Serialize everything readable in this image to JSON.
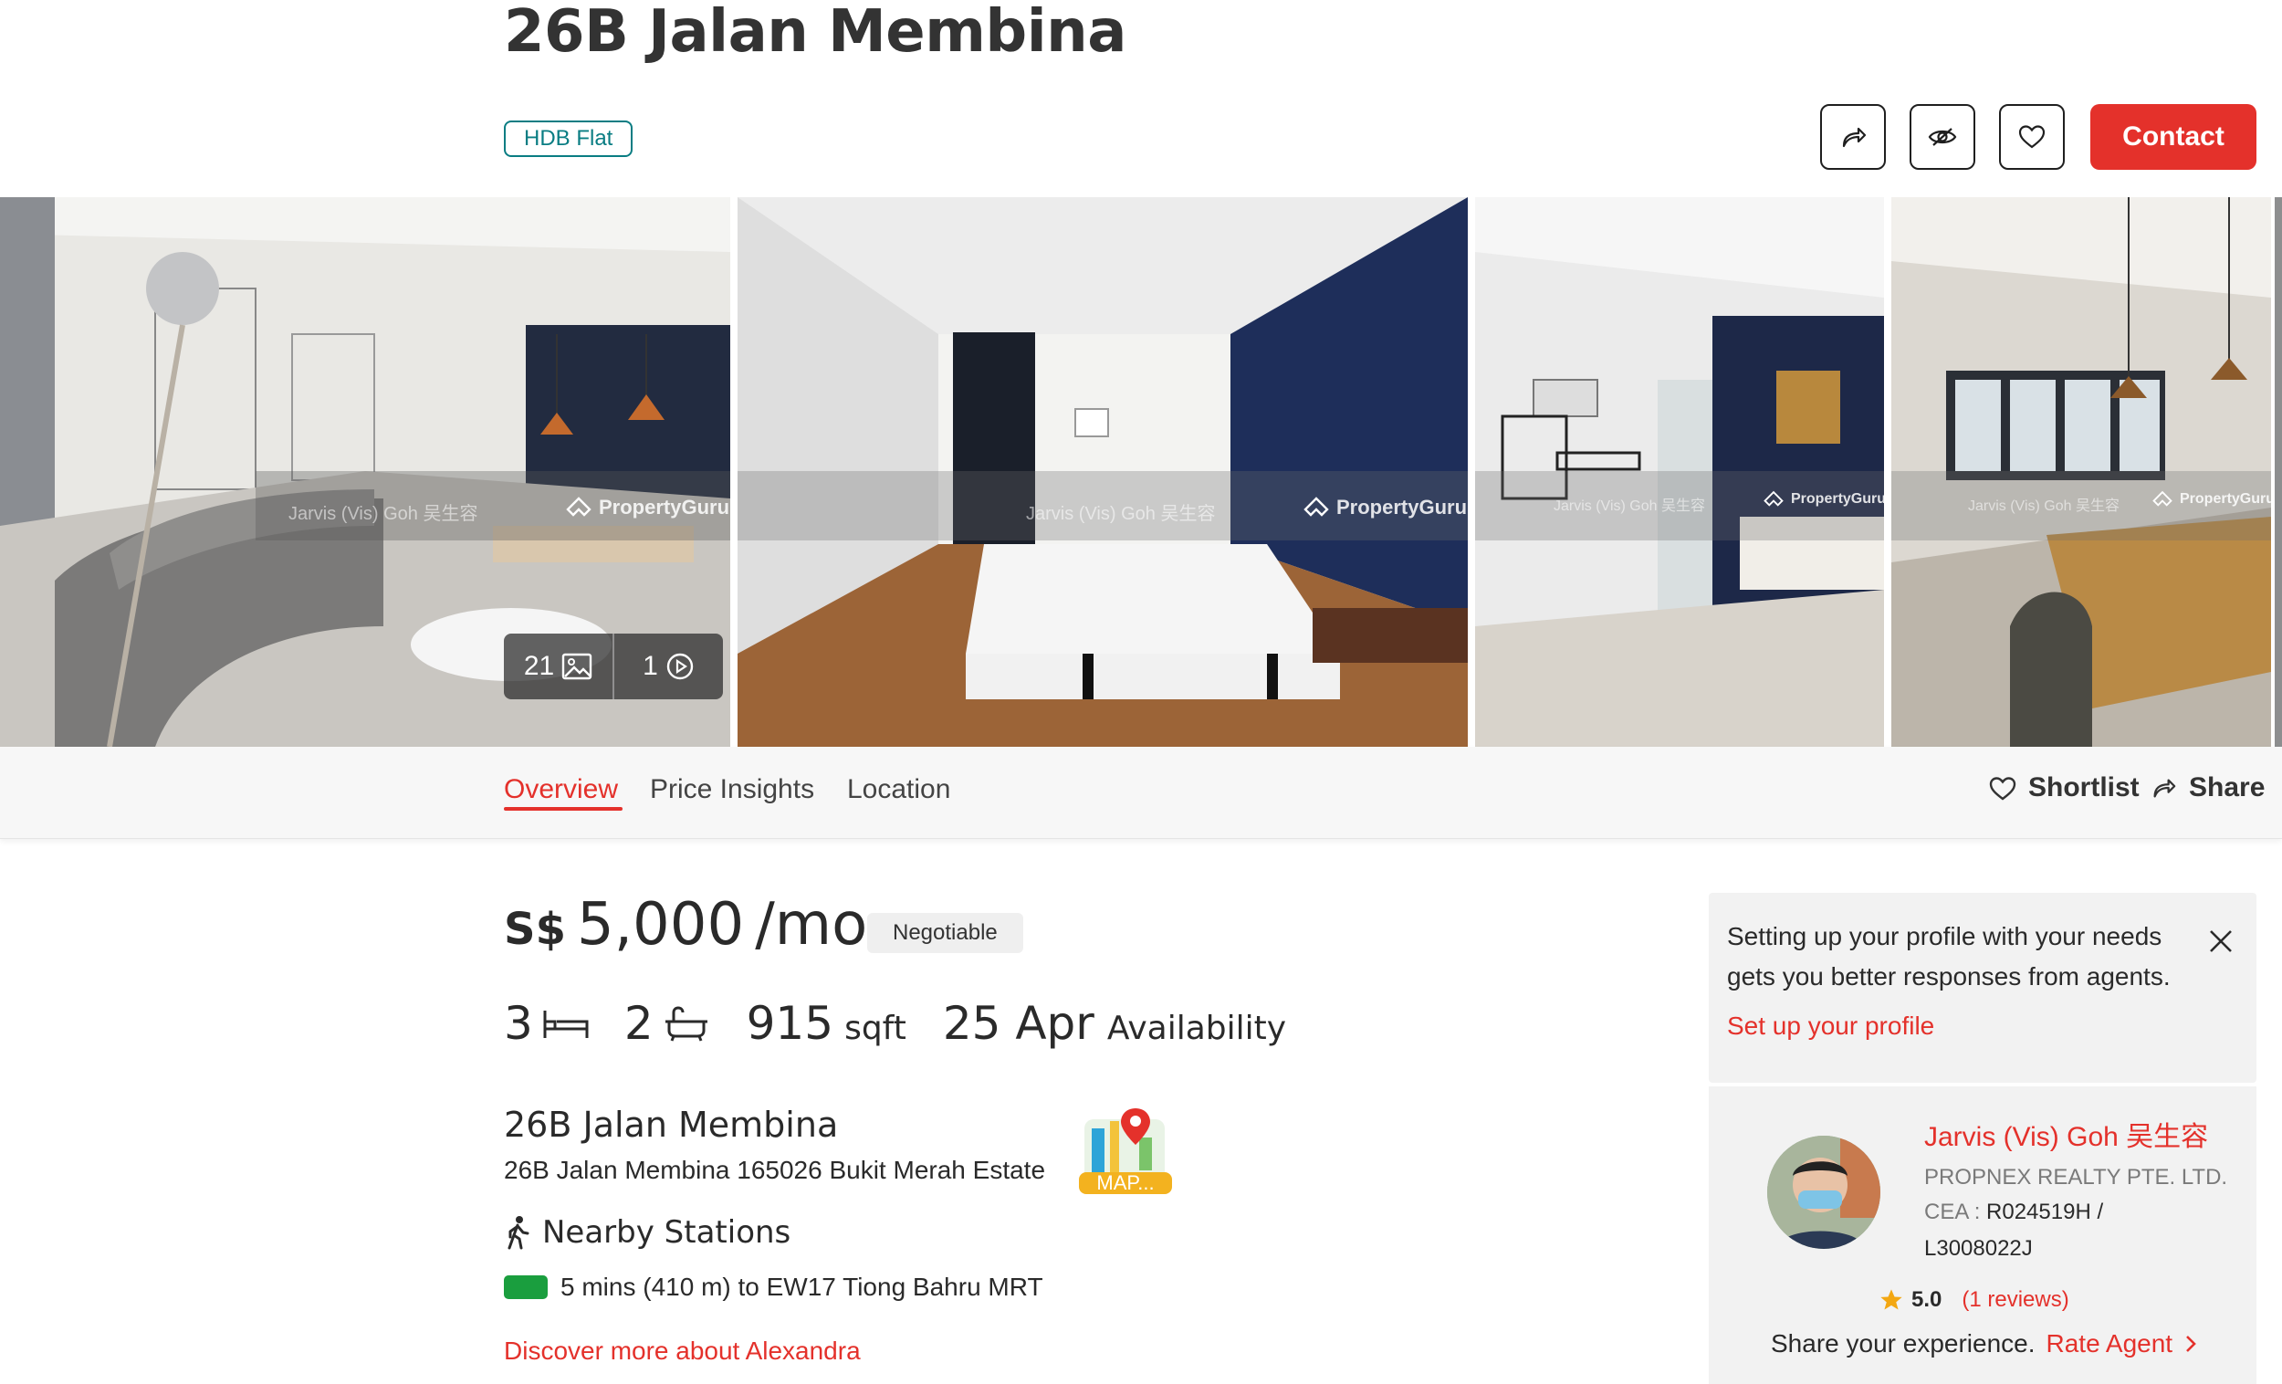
{
  "listing": {
    "title": "26B Jalan Membina",
    "property_type": "HDB Flat"
  },
  "actions": {
    "share_icon": "share-arrow-icon",
    "hide_icon": "eye-hide-icon",
    "favorite_icon": "heart-icon",
    "contact_label": "Contact"
  },
  "gallery": {
    "photo_count": "21",
    "video_count": "1",
    "watermark_brand": "PropertyGuru",
    "watermark_agent": "Jarvis (Vis) Goh 吴生容"
  },
  "tabs": {
    "items": [
      "Overview",
      "Price Insights",
      "Location"
    ],
    "active": "Overview",
    "shortlist_label": "Shortlist",
    "share_label": "Share"
  },
  "price": {
    "currency": "S$",
    "amount": "5,000",
    "period": "/mo",
    "negotiable": "Negotiable"
  },
  "specs": {
    "bedrooms": "3",
    "bathrooms": "2",
    "area_value": "915",
    "area_unit": "sqft",
    "availability_date": "25 Apr",
    "availability_label": "Availability"
  },
  "address": {
    "name": "26B Jalan Membina",
    "full": "26B Jalan Membina 165026 Bukit Merah Estate",
    "map_label": "MAP..."
  },
  "nearby": {
    "heading": "Nearby Stations",
    "station": "5 mins (410 m) to EW17 Tiong Bahru MRT",
    "discover_link": "Discover more about Alexandra"
  },
  "profile_prompt": {
    "text": "Setting up your profile with your needs gets you better responses from agents.",
    "link": "Set up your profile"
  },
  "agent": {
    "name": "Jarvis (Vis) Goh 吴生容",
    "agency": "PROPNEX REALTY PTE. LTD.",
    "cea_label": "CEA :",
    "cea_number": "R024519H /",
    "cea_number_2": "L3008022J",
    "rating": "5.0",
    "reviews": "(1 reviews)",
    "share_prompt": "Share your experience.",
    "rate_link": "Rate Agent"
  },
  "colors": {
    "accent": "#e4312b",
    "badge": "#0a7d83",
    "mrt_line": "#1a9e3e"
  }
}
